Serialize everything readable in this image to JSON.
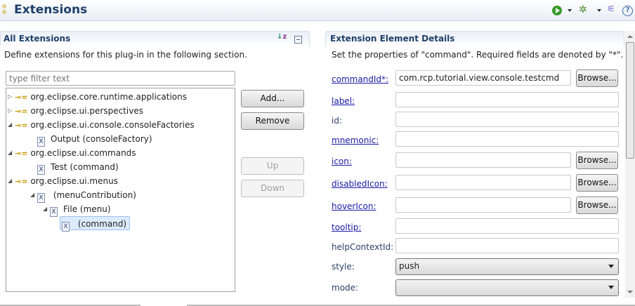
{
  "header": {
    "title": "Extensions",
    "icons": [
      "run-icon",
      "debug-icon",
      "plugin-icon",
      "help-icon"
    ]
  },
  "left": {
    "title": "All Extensions",
    "description": "Define extensions for this plug-in in the following section.",
    "filter_placeholder": "type filter text",
    "tree": [
      {
        "label": "org.eclipse.core.runtime.applications",
        "level": 0,
        "expanded": false,
        "type": "extension"
      },
      {
        "label": "org.eclipse.ui.perspectives",
        "level": 0,
        "expanded": false,
        "type": "extension"
      },
      {
        "label": "org.eclipse.ui.console.consoleFactories",
        "level": 0,
        "expanded": true,
        "type": "extension"
      },
      {
        "label": "Output (consoleFactory)",
        "level": 1,
        "type": "element"
      },
      {
        "label": "org.eclipse.ui.commands",
        "level": 0,
        "expanded": true,
        "type": "extension"
      },
      {
        "label": "Test (command)",
        "level": 1,
        "type": "element"
      },
      {
        "label": "org.eclipse.ui.menus",
        "level": 0,
        "expanded": true,
        "type": "extension"
      },
      {
        "label": " (menuContribution)",
        "level": 1,
        "expanded": true,
        "type": "element"
      },
      {
        "label": "File (menu)",
        "level": 2,
        "expanded": true,
        "type": "element"
      },
      {
        "label": " (command)",
        "level": 3,
        "type": "element",
        "selected": true
      }
    ],
    "buttons": {
      "add": "Add...",
      "remove": "Remove",
      "up": "Up",
      "down": "Down"
    }
  },
  "right": {
    "title": "Extension Element Details",
    "description": "Set the properties of \"command\". Required fields are denoted by \"*\".",
    "browse": "Browse...",
    "fields": [
      {
        "label": "commandId*:",
        "value": "com.rcp.tutorial.view.console.testcmd",
        "link": true,
        "browse": true
      },
      {
        "label": "label:",
        "value": "",
        "link": true
      },
      {
        "label": "id:",
        "value": "",
        "link": false
      },
      {
        "label": "mnemonic:",
        "value": "",
        "link": true
      },
      {
        "label": "icon:",
        "value": "",
        "link": true,
        "browse": true
      },
      {
        "label": "disabledIcon:",
        "value": "",
        "link": true,
        "browse": true
      },
      {
        "label": "hoverIcon:",
        "value": "",
        "link": true,
        "browse": true
      },
      {
        "label": "tooltip:",
        "value": "",
        "link": true
      },
      {
        "label": "helpContextId:",
        "value": "",
        "link": false
      }
    ],
    "style": {
      "label": "style:",
      "value": "push"
    },
    "mode": {
      "label": "mode:",
      "value": ""
    }
  }
}
